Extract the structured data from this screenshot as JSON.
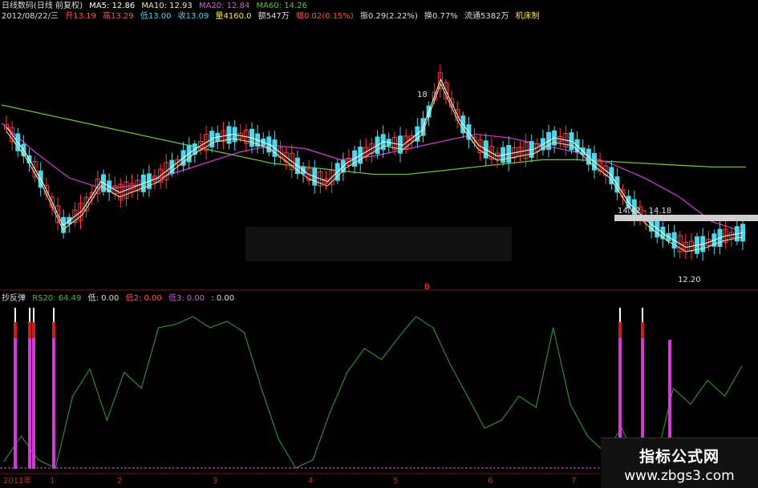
{
  "header": {
    "row1": {
      "title": "日线数码(日线 前复权)",
      "ma5": "MA5: 12.86",
      "ma10": "MA10: 12.93",
      "ma20": "MA20: 12.84",
      "ma60": "MA60: 14.26"
    },
    "row2": {
      "date": "2012/08/22/三",
      "open": "开13.19",
      "high": "高13.29",
      "low": "低13.00",
      "close": "收13.09",
      "vol": "量4160.0",
      "amount": "额547万",
      "change": "幅0.02(0.15%)",
      "amp": "振0.29(2.22%)",
      "turnover": "换0.77%",
      "float": "流通5382万",
      "industry": "机床制"
    }
  },
  "price_labels": {
    "peak": "18",
    "range": "14.42 - 14.18",
    "low": "12.20",
    "marker": "B"
  },
  "indicator": {
    "name": "抄反弹",
    "rs": "RS20: 64.49",
    "low": "低: 0.00",
    "low2": "低2: 0.00",
    "low3": "低3: 0.00",
    "extra": ": 0.00"
  },
  "xaxis": {
    "labels": [
      "2011年",
      "1",
      "2",
      "3",
      "4",
      "5",
      "6",
      "7"
    ]
  },
  "watermark": {
    "line1": "指标公式网",
    "line2": "www.zbgs3.com"
  },
  "colors": {
    "up": "#ff3b3b",
    "down": "#4fd6e8",
    "ma5": "#ffffff",
    "ma10": "#f5e6a0",
    "ma20": "#c83cc8",
    "ma60": "#6fbf3c",
    "rs": "#2f8a2f",
    "signal": "#d63ad6"
  },
  "chart_data": [
    {
      "type": "line",
      "title": "",
      "series": [
        {
          "name": "MA60",
          "values": [
            16.5,
            16.3,
            16.1,
            15.9,
            15.7,
            15.5,
            15.3,
            15.1,
            14.9,
            14.8,
            14.7,
            14.6,
            14.6,
            14.7,
            14.8,
            14.9,
            15.0,
            15.0,
            14.95,
            14.9,
            14.85,
            14.8,
            14.8
          ]
        },
        {
          "name": "MA20",
          "values": [
            16.0,
            15.2,
            14.5,
            14.2,
            14.3,
            14.6,
            14.9,
            15.2,
            15.4,
            15.3,
            15.0,
            15.1,
            15.3,
            15.5,
            15.7,
            15.6,
            15.4,
            15.2,
            14.9,
            14.5,
            14.0,
            13.3,
            13.0
          ]
        }
      ],
      "ylabel": "",
      "xlabel": ""
    },
    {
      "type": "line",
      "title": "",
      "series": [
        {
          "name": "RS20",
          "values": [
            4,
            20,
            5,
            0,
            45,
            62,
            30,
            60,
            50,
            88,
            90,
            95,
            88,
            92,
            85,
            50,
            18,
            0,
            5,
            35,
            60,
            75,
            68,
            82,
            95,
            88,
            65,
            45,
            25,
            30,
            45,
            38,
            88,
            40,
            20,
            10,
            25,
            0,
            5,
            50,
            40,
            55,
            45,
            64
          ]
        }
      ],
      "ylim": [
        0,
        100
      ]
    }
  ]
}
